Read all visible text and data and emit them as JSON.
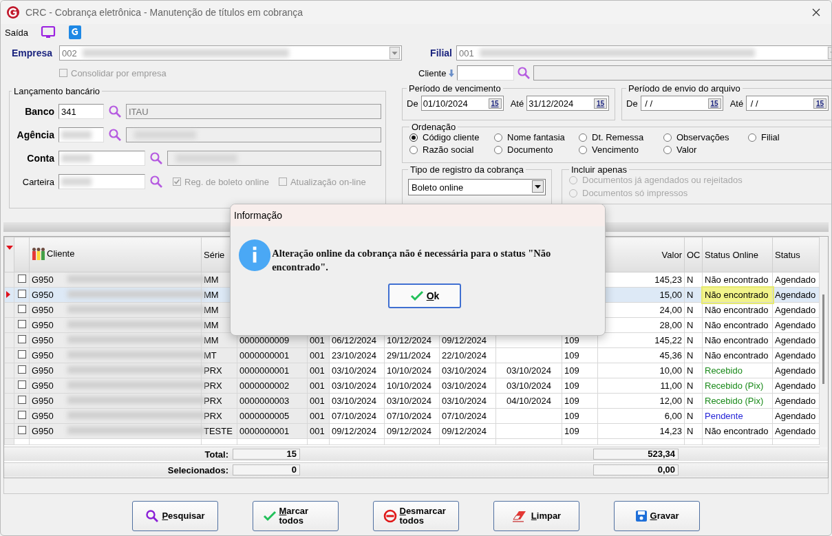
{
  "window": {
    "title": "CRC - Cobrança eletrônica - Manutenção de títulos em cobrança"
  },
  "toolbar": {
    "label": "Saída"
  },
  "empresa": {
    "label": "Empresa",
    "value": "002",
    "redacted": true
  },
  "filial": {
    "label": "Filial",
    "value": "001",
    "redacted": true
  },
  "consolidar": {
    "label": "Consolidar por empresa",
    "checked": false,
    "disabled": true
  },
  "cliente": {
    "label": "Cliente"
  },
  "lancamento": {
    "title": "Lançamento bancário",
    "fields": [
      {
        "label": "Banco",
        "required": true,
        "value": "341",
        "description": "ITAU",
        "redacted": false
      },
      {
        "label": "Agência",
        "required": true,
        "redacted": true
      },
      {
        "label": "Conta",
        "required": true,
        "redacted": true
      },
      {
        "label": "Carteira",
        "required": false,
        "redacted": true,
        "checks": [
          {
            "label": "Reg. de boleto online",
            "checked": true,
            "disabled": true
          },
          {
            "label": "Atualização on-line",
            "checked": false,
            "disabled": true
          }
        ]
      }
    ]
  },
  "periods": [
    {
      "title": "Período de vencimento",
      "dates": [
        {
          "label": "De",
          "value": "01/10/2024",
          "button": "15"
        },
        {
          "label": "Até",
          "value": "31/12/2024",
          "button": "15"
        }
      ]
    },
    {
      "title": "Período de envio do arquivo",
      "dates": [
        {
          "label": "De",
          "value": " / /",
          "button": "15"
        },
        {
          "label": "Até",
          "value": " / /",
          "button": "15"
        }
      ]
    }
  ],
  "ordenacao": {
    "title": "Ordenação",
    "options": [
      {
        "label": "Código cliente",
        "selected": true
      },
      {
        "label": "Nome fantasia",
        "selected": false
      },
      {
        "label": "Dt. Remessa",
        "selected": false
      },
      {
        "label": "Observações",
        "selected": false
      },
      {
        "label": "Filial",
        "selected": false
      },
      {
        "label": "Razão social",
        "selected": false
      },
      {
        "label": "Documento",
        "selected": false
      },
      {
        "label": "Vencimento",
        "selected": false
      },
      {
        "label": "Valor",
        "selected": false
      }
    ]
  },
  "tipo": {
    "title": "Tipo de registro da cobrança",
    "value": "Boleto online"
  },
  "incluir": {
    "title": "Incluir apenas",
    "options": [
      {
        "label": "Documentos já agendados ou rejeitados",
        "selected": false,
        "disabled": true
      },
      {
        "label": "Documentos só impressos",
        "selected": false,
        "disabled": true
      }
    ]
  },
  "table": {
    "headers": {
      "cliente": "Cliente",
      "serie": "Série",
      "valor": "Valor",
      "oc": "OC",
      "status_online": "Status Online",
      "status": "Status"
    },
    "rows": [
      {
        "selected": false,
        "checked": false,
        "code": "G950",
        "serie": "MM",
        "valor": "145,23",
        "oc": "N",
        "status_online": "Não encontrado",
        "color": "#000000",
        "highlighted": false,
        "status": "Agendado"
      },
      {
        "selected": true,
        "checked": false,
        "code": "G950",
        "serie": "MM",
        "valor": "15,00",
        "oc": "N",
        "status_online": "Não encontrado",
        "color": "#000000",
        "highlighted": true,
        "status": "Agendado"
      },
      {
        "selected": false,
        "checked": false,
        "code": "G950",
        "serie": "MM",
        "valor": "24,00",
        "oc": "N",
        "status_online": "Não encontrado",
        "color": "#000000",
        "highlighted": false,
        "status": "Agendado"
      },
      {
        "selected": false,
        "checked": false,
        "code": "G950",
        "serie": "MM",
        "valor": "28,00",
        "oc": "N",
        "status_online": "Não encontrado",
        "color": "#000000",
        "highlighted": false,
        "status": "Agendado"
      },
      {
        "selected": false,
        "checked": false,
        "code": "G950",
        "serie": "MM",
        "column_5": "0000000009",
        "column_6": "001",
        "column_7": "06/12/2024",
        "column_8": "10/12/2024",
        "column_9": "09/12/2024",
        "column_11": "109",
        "valor": "145,22",
        "oc": "N",
        "status_online": "Não encontrado",
        "color": "#000000",
        "highlighted": false,
        "status": "Agendado"
      },
      {
        "selected": false,
        "checked": false,
        "code": "G950",
        "serie": "MT",
        "column_5": "0000000001",
        "column_6": "001",
        "column_7": "23/10/2024",
        "column_8": "29/11/2024",
        "column_9": "22/10/2024",
        "column_11": "109",
        "valor": "45,36",
        "oc": "N",
        "status_online": "Não encontrado",
        "color": "#000000",
        "highlighted": false,
        "status": "Agendado"
      },
      {
        "selected": false,
        "checked": false,
        "code": "G950",
        "serie": "PRX",
        "column_5": "0000000001",
        "column_6": "001",
        "column_7": "03/10/2024",
        "column_8": "10/10/2024",
        "column_9": "03/10/2024",
        "column_10": "03/10/2024",
        "column_11": "109",
        "valor": "10,00",
        "oc": "N",
        "status_online": "Recebido",
        "color": "#1a8a1a",
        "highlighted": false,
        "status": "Agendado"
      },
      {
        "selected": false,
        "checked": false,
        "code": "G950",
        "serie": "PRX",
        "column_5": "0000000002",
        "column_6": "001",
        "column_7": "03/10/2024",
        "column_8": "10/10/2024",
        "column_9": "03/10/2024",
        "column_10": "03/10/2024",
        "column_11": "109",
        "valor": "11,00",
        "oc": "N",
        "status_online": "Recebido (Pix)",
        "color": "#1a8a1a",
        "highlighted": false,
        "status": "Agendado"
      },
      {
        "selected": false,
        "checked": false,
        "code": "G950",
        "serie": "PRX",
        "column_5": "0000000003",
        "column_6": "001",
        "column_7": "03/10/2024",
        "column_8": "03/10/2024",
        "column_9": "03/10/2024",
        "column_10": "04/10/2024",
        "column_11": "109",
        "valor": "12,00",
        "oc": "N",
        "status_online": "Recebido (Pix)",
        "color": "#1a8a1a",
        "highlighted": false,
        "status": "Agendado"
      },
      {
        "selected": false,
        "checked": false,
        "code": "G950",
        "serie": "PRX",
        "column_5": "0000000005",
        "column_6": "001",
        "column_7": "07/10/2024",
        "column_8": "07/10/2024",
        "column_9": "07/10/2024",
        "column_11": "109",
        "valor": "6,00",
        "oc": "N",
        "status_online": "Pendente",
        "color": "#1f1fd6",
        "highlighted": false,
        "status": "Agendado"
      },
      {
        "selected": false,
        "checked": false,
        "code": "G950",
        "serie": "TESTE",
        "column_5": "0000000001",
        "column_6": "001",
        "column_7": "09/12/2024",
        "column_8": "09/12/2024",
        "column_9": "09/12/2024",
        "column_11": "109",
        "valor": "14,23",
        "oc": "N",
        "status_online": "Não encontrado",
        "color": "#000000",
        "highlighted": false,
        "status": "Agendado"
      }
    ],
    "totals": [
      {
        "label": "Total:",
        "count": "15",
        "sum": "523,34"
      },
      {
        "label": "Selecionados:",
        "count": "0",
        "sum": "0,00"
      }
    ]
  },
  "dialog": {
    "title": "Informação",
    "message": "Alteração online da cobrança não é necessária para o status \"Não encontrado\".",
    "button": "Ok"
  },
  "buttons": [
    {
      "label": "Pesquisar",
      "kind": "search"
    },
    {
      "label": "Marcar todos",
      "kind": "check"
    },
    {
      "label": "Desmarcar todos",
      "kind": "uncheck"
    },
    {
      "label": "Limpar",
      "kind": "eraser"
    },
    {
      "label": "Gravar",
      "kind": "save"
    }
  ]
}
